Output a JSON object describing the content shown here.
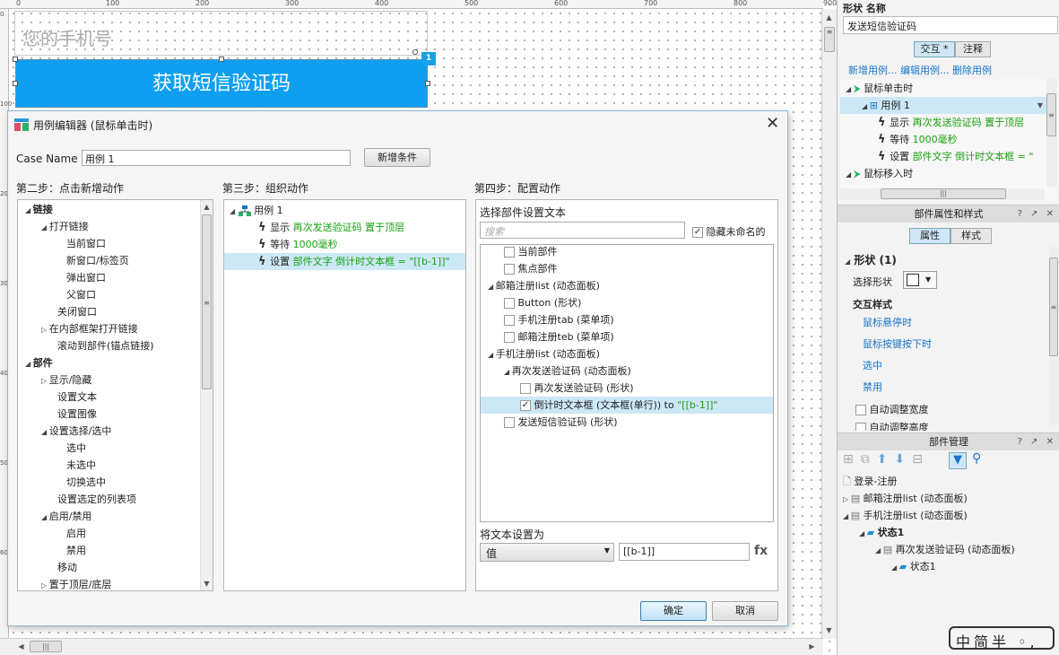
{
  "ruler": {
    "top": [
      "0",
      "100",
      "200",
      "300",
      "400",
      "500",
      "600",
      "700",
      "800",
      "900"
    ],
    "left": [
      "0",
      "100",
      "200",
      "300",
      "400",
      "500",
      "600"
    ]
  },
  "canvas": {
    "phone_placeholder": "您的手机号",
    "sms_button": "获取短信验证码",
    "badge": "1"
  },
  "dialog": {
    "title": "用例编辑器 (鼠标单击时)",
    "close": "✕",
    "case_name_label": "Case Name",
    "case_name_value": "用例 1",
    "add_condition": "新增条件",
    "step2": "第二步：点击新增动作",
    "step3": "第三步：组织动作",
    "step4": "第四步：配置动作",
    "actions": [
      {
        "label": "链接",
        "level": 0,
        "expand": "open",
        "bold": true
      },
      {
        "label": "打开链接",
        "level": 1,
        "expand": "open"
      },
      {
        "label": "当前窗口",
        "level": 2
      },
      {
        "label": "新窗口/标签页",
        "level": 2
      },
      {
        "label": "弹出窗口",
        "level": 2
      },
      {
        "label": "父窗口",
        "level": 2
      },
      {
        "label": "关闭窗口",
        "level": 1
      },
      {
        "label": "在内部框架打开链接",
        "level": 1,
        "expand": "closed"
      },
      {
        "label": "滚动到部件(锚点链接)",
        "level": 1
      },
      {
        "label": "部件",
        "level": 0,
        "expand": "open",
        "bold": true
      },
      {
        "label": "显示/隐藏",
        "level": 1,
        "expand": "closed"
      },
      {
        "label": "设置文本",
        "level": 1
      },
      {
        "label": "设置图像",
        "level": 1
      },
      {
        "label": "设置选择/选中",
        "level": 1,
        "expand": "open"
      },
      {
        "label": "选中",
        "level": 2
      },
      {
        "label": "未选中",
        "level": 2
      },
      {
        "label": "切换选中",
        "level": 2
      },
      {
        "label": "设置选定的列表项",
        "level": 1
      },
      {
        "label": "启用/禁用",
        "level": 1,
        "expand": "open"
      },
      {
        "label": "启用",
        "level": 2
      },
      {
        "label": "禁用",
        "level": 2
      },
      {
        "label": "移动",
        "level": 1
      },
      {
        "label": "置于顶层/底层",
        "level": 1,
        "expand": "closed"
      }
    ],
    "organize": {
      "case": "用例 1",
      "items": [
        {
          "verb": "显示",
          "detail": "再次发送验证码 置于顶层"
        },
        {
          "verb": "等待",
          "detail": "1000毫秒"
        },
        {
          "verb": "设置",
          "detail": "部件文字 倒计时文本框 = \"[[b-1]]\""
        }
      ]
    },
    "config": {
      "title": "选择部件设置文本",
      "search_placeholder": "搜索",
      "hide_unnamed": "隐藏未命名的",
      "widgets": [
        {
          "label": "当前部件",
          "level": 1,
          "check": true
        },
        {
          "label": "焦点部件",
          "level": 1,
          "check": true
        },
        {
          "label": "邮箱注册list (动态面板)",
          "level": 0,
          "expand": "open"
        },
        {
          "label": "Button (形状)",
          "level": 1,
          "check": true
        },
        {
          "label": "手机注册tab (菜单项)",
          "level": 1,
          "check": true
        },
        {
          "label": "邮箱注册teb (菜单项)",
          "level": 1,
          "check": true
        },
        {
          "label": "手机注册list (动态面板)",
          "level": 0,
          "expand": "open"
        },
        {
          "label": "再次发送验证码 (动态面板)",
          "level": 1,
          "expand": "open"
        },
        {
          "label": "再次发送验证码 (形状)",
          "level": 2,
          "check": true
        },
        {
          "label": "倒计时文本框 (文本框(单行))",
          "suffix": " to ",
          "value": "\"[[b-1]]\"",
          "level": 2,
          "check": true,
          "checked": true,
          "selected": true
        },
        {
          "label": "发送短信验证码 (形状)",
          "level": 1,
          "check": true
        }
      ],
      "set_text_label": "将文本设置为",
      "value_type": "值",
      "value": "[[b-1]]",
      "fx": "fx"
    },
    "ok": "确定",
    "cancel": "取消"
  },
  "right": {
    "shape_label": "形状",
    "name_label": "名称",
    "name_value": "发送短信验证码",
    "tab_interact": "交互 *",
    "tab_note": "注释",
    "case_links": [
      "新增用例...",
      "编辑用例...",
      "删除用例"
    ],
    "events": [
      {
        "label": "鼠标单击时",
        "level": 0
      },
      {
        "label": "用例 1",
        "level": 1,
        "selected": true
      },
      {
        "verb": "显示",
        "detail": "再次发送验证码 置于顶层",
        "level": 2
      },
      {
        "verb": "等待",
        "detail": "1000毫秒",
        "level": 2
      },
      {
        "verb": "设置",
        "detail": "部件文字 倒计时文本框 = \"",
        "level": 2
      },
      {
        "label": "鼠标移入时",
        "level": 0
      }
    ],
    "props_title": "部件属性和样式",
    "tab_props": "属性",
    "tab_style": "样式",
    "shape_section": "形状 (1)",
    "select_shape": "选择形状",
    "interaction_style": "交互样式",
    "styles": [
      "鼠标悬停时",
      "鼠标按键按下时",
      "选中",
      "禁用"
    ],
    "auto_width": "自动调整宽度",
    "auto_height": "自动调整高度",
    "outline_title": "部件管理",
    "outline": [
      {
        "label": "登录-注册",
        "level": 0,
        "type": "page"
      },
      {
        "label": "邮箱注册list (动态面板)",
        "level": 0,
        "type": "panel",
        "expand": "closed"
      },
      {
        "label": "手机注册list (动态面板)",
        "level": 0,
        "type": "panel",
        "expand": "open"
      },
      {
        "label": "状态1",
        "level": 1,
        "type": "state",
        "expand": "open",
        "bold": true
      },
      {
        "label": "再次发送验证码 (动态面板)",
        "level": 2,
        "type": "panel",
        "expand": "open"
      },
      {
        "label": "状态1",
        "level": 3,
        "type": "state",
        "expand": "open"
      }
    ]
  },
  "ime": "中简半 ◦,",
  "colors": {
    "accent": "#0f9ff0",
    "green_text": "#1aa10f",
    "selection": "#cce8f6",
    "link": "#1a74c8"
  }
}
